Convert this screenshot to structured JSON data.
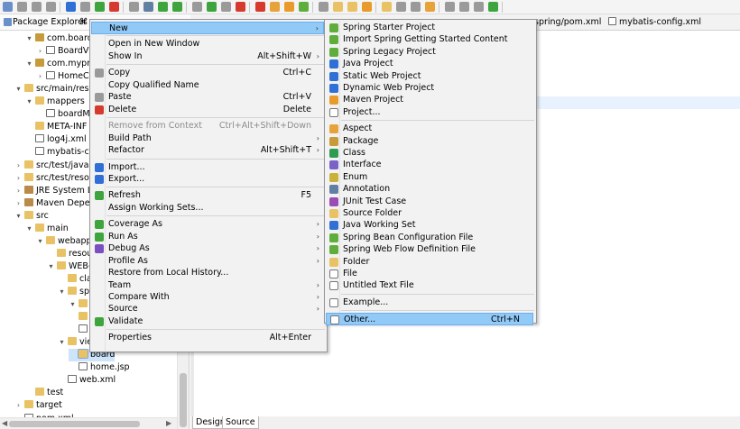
{
  "toolbar": {
    "buttons": 48
  },
  "explorer": {
    "title": "Package Explorer",
    "tab_marker": "⌘",
    "tree": [
      {
        "label": "com.board.c",
        "indent": 2,
        "twisty": "▾",
        "icon": "pkg"
      },
      {
        "label": "BoardVC",
        "indent": 3,
        "twisty": "›",
        "icon": "file"
      },
      {
        "label": "com.myproj",
        "indent": 2,
        "twisty": "▾",
        "icon": "pkg"
      },
      {
        "label": "HomeCo",
        "indent": 3,
        "twisty": "›",
        "icon": "file"
      },
      {
        "label": "src/main/resou",
        "indent": 1,
        "twisty": "▾",
        "icon": "fold"
      },
      {
        "label": "mappers",
        "indent": 2,
        "twisty": "▾",
        "icon": "fold"
      },
      {
        "label": "boardMa",
        "indent": 3,
        "twisty": "",
        "icon": "file"
      },
      {
        "label": "META-INF",
        "indent": 2,
        "twisty": "",
        "icon": "fold"
      },
      {
        "label": "log4j.xml",
        "indent": 2,
        "twisty": "",
        "icon": "file"
      },
      {
        "label": "mybatis-con",
        "indent": 2,
        "twisty": "",
        "icon": "file"
      },
      {
        "label": "src/test/java",
        "indent": 1,
        "twisty": "›",
        "icon": "fold"
      },
      {
        "label": "src/test/resour",
        "indent": 1,
        "twisty": "›",
        "icon": "fold"
      },
      {
        "label": "JRE System Lib",
        "indent": 1,
        "twisty": "›",
        "icon": "lib"
      },
      {
        "label": "Maven Depen",
        "indent": 1,
        "twisty": "›",
        "icon": "lib"
      },
      {
        "label": "src",
        "indent": 1,
        "twisty": "▾",
        "icon": "fold"
      },
      {
        "label": "main",
        "indent": 2,
        "twisty": "▾",
        "icon": "fold"
      },
      {
        "label": "webapp",
        "indent": 3,
        "twisty": "▾",
        "icon": "fold"
      },
      {
        "label": "resou",
        "indent": 4,
        "twisty": "",
        "icon": "fold"
      },
      {
        "label": "WEB-",
        "indent": 4,
        "twisty": "▾",
        "icon": "fold"
      },
      {
        "label": "cla",
        "indent": 5,
        "twisty": "",
        "icon": "fold"
      },
      {
        "label": "spr",
        "indent": 5,
        "twisty": "▾",
        "icon": "fold"
      },
      {
        "label": "",
        "indent": 6,
        "twisty": "▾",
        "icon": "fold"
      },
      {
        "label": "",
        "indent": 6,
        "twisty": "",
        "icon": "fold"
      },
      {
        "label": "",
        "indent": 6,
        "twisty": "",
        "icon": "file"
      },
      {
        "label": "vie",
        "indent": 5,
        "twisty": "▾",
        "icon": "fold"
      },
      {
        "label": "board",
        "indent": 6,
        "twisty": "",
        "icon": "sel"
      },
      {
        "label": "home.jsp",
        "indent": 6,
        "twisty": "",
        "icon": "file"
      },
      {
        "label": "web.xml",
        "indent": 5,
        "twisty": "",
        "icon": "file"
      },
      {
        "label": "test",
        "indent": 2,
        "twisty": "",
        "icon": "fold"
      },
      {
        "label": "target",
        "indent": 1,
        "twisty": "›",
        "icon": "fold"
      },
      {
        "label": "pom.xml",
        "indent": 1,
        "twisty": "",
        "icon": "file"
      }
    ]
  },
  "editor": {
    "tabs": [
      "spring/pom.xml",
      "mybatis-config.xml"
    ],
    "bottom_tabs": [
      "Design",
      "Source"
    ]
  },
  "context_menu": {
    "items": [
      {
        "label": "New",
        "accel": "",
        "submenu": true,
        "icon": "",
        "highlight": true
      },
      {
        "sep": true
      },
      {
        "label": "Open in New Window",
        "accel": "",
        "submenu": false,
        "icon": ""
      },
      {
        "label": "Show In",
        "accel": "Alt+Shift+W",
        "submenu": true,
        "icon": ""
      },
      {
        "sep": true
      },
      {
        "label": "Copy",
        "accel": "Ctrl+C",
        "submenu": false,
        "icon": "gray"
      },
      {
        "label": "Copy Qualified Name",
        "accel": "",
        "submenu": false,
        "icon": ""
      },
      {
        "label": "Paste",
        "accel": "Ctrl+V",
        "submenu": false,
        "icon": "gray"
      },
      {
        "label": "Delete",
        "accel": "Delete",
        "submenu": false,
        "icon": "red"
      },
      {
        "sep": true
      },
      {
        "label": "Remove from Context",
        "accel": "Ctrl+Alt+Shift+Down",
        "submenu": false,
        "icon": "",
        "disabled": true
      },
      {
        "label": "Build Path",
        "accel": "",
        "submenu": true,
        "icon": ""
      },
      {
        "label": "Refactor",
        "accel": "Alt+Shift+T",
        "submenu": true,
        "icon": ""
      },
      {
        "sep": true
      },
      {
        "label": "Import...",
        "accel": "",
        "submenu": false,
        "icon": "blue"
      },
      {
        "label": "Export...",
        "accel": "",
        "submenu": false,
        "icon": "blue"
      },
      {
        "sep": true
      },
      {
        "label": "Refresh",
        "accel": "F5",
        "submenu": false,
        "icon": "green"
      },
      {
        "label": "Assign Working Sets...",
        "accel": "",
        "submenu": false,
        "icon": ""
      },
      {
        "sep": true
      },
      {
        "label": "Coverage As",
        "accel": "",
        "submenu": true,
        "icon": "green"
      },
      {
        "label": "Run As",
        "accel": "",
        "submenu": true,
        "icon": "green"
      },
      {
        "label": "Debug As",
        "accel": "",
        "submenu": true,
        "icon": "purple"
      },
      {
        "label": "Profile As",
        "accel": "",
        "submenu": true,
        "icon": ""
      },
      {
        "label": "Restore from Local History...",
        "accel": "",
        "submenu": false,
        "icon": ""
      },
      {
        "label": "Team",
        "accel": "",
        "submenu": true,
        "icon": ""
      },
      {
        "label": "Compare With",
        "accel": "",
        "submenu": true,
        "icon": ""
      },
      {
        "label": "Source",
        "accel": "",
        "submenu": true,
        "icon": ""
      },
      {
        "label": "Validate",
        "accel": "",
        "submenu": false,
        "icon": "green"
      },
      {
        "sep": true
      },
      {
        "label": "Properties",
        "accel": "Alt+Enter",
        "submenu": false,
        "icon": ""
      }
    ]
  },
  "new_submenu": {
    "items": [
      {
        "label": "Spring Starter Project",
        "accel": "",
        "icon": "leaf"
      },
      {
        "label": "Import Spring Getting Started Content",
        "accel": "",
        "icon": "leaf"
      },
      {
        "label": "Spring Legacy Project",
        "accel": "",
        "icon": "leaf"
      },
      {
        "label": "Java Project",
        "accel": "",
        "icon": "blue"
      },
      {
        "label": "Static Web Project",
        "accel": "",
        "icon": "blue"
      },
      {
        "label": "Dynamic Web Project",
        "accel": "",
        "icon": "blue"
      },
      {
        "label": "Maven Project",
        "accel": "",
        "icon": "orange"
      },
      {
        "label": "Project...",
        "accel": "",
        "icon": "file"
      },
      {
        "sep": true
      },
      {
        "label": "Aspect",
        "accel": "",
        "icon": "aspect"
      },
      {
        "label": "Package",
        "accel": "",
        "icon": "pkg"
      },
      {
        "label": "Class",
        "accel": "",
        "icon": "class"
      },
      {
        "label": "Interface",
        "accel": "",
        "icon": "int"
      },
      {
        "label": "Enum",
        "accel": "",
        "icon": "enum"
      },
      {
        "label": "Annotation",
        "accel": "",
        "icon": "ann"
      },
      {
        "label": "JUnit Test Case",
        "accel": "",
        "icon": "junit"
      },
      {
        "label": "Source Folder",
        "accel": "",
        "icon": "folder"
      },
      {
        "label": "Java Working Set",
        "accel": "",
        "icon": "blue"
      },
      {
        "label": "Spring Bean Configuration File",
        "accel": "",
        "icon": "leaf"
      },
      {
        "label": "Spring Web Flow Definition File",
        "accel": "",
        "icon": "leaf"
      },
      {
        "label": "Folder",
        "accel": "",
        "icon": "folder"
      },
      {
        "label": "File",
        "accel": "",
        "icon": "file"
      },
      {
        "label": "Untitled Text File",
        "accel": "",
        "icon": "file"
      },
      {
        "sep": true
      },
      {
        "label": "Example...",
        "accel": "",
        "icon": "file"
      },
      {
        "sep": true
      },
      {
        "label": "Other...",
        "accel": "Ctrl+N",
        "icon": "file",
        "highlight": true
      }
    ]
  }
}
